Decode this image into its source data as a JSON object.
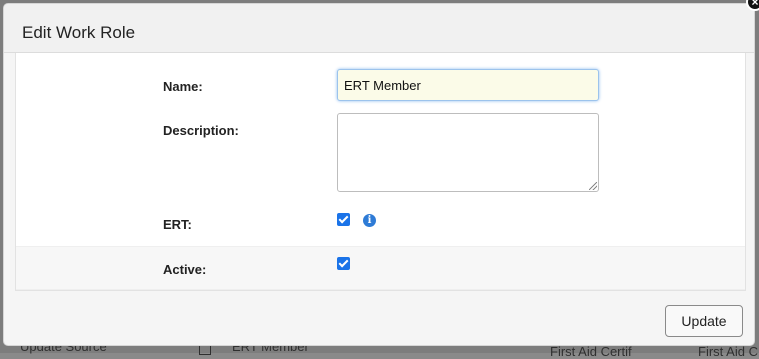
{
  "background": {
    "update_source_text": "Update Source",
    "ert_member_text": "ERT Member",
    "first_aid_1_text": "First Aid Certif",
    "first_aid_2_text": "First Aid C"
  },
  "dialog": {
    "title": "Edit Work Role",
    "fields": {
      "name_label": "Name:",
      "name_value": "ERT Member",
      "description_label": "Description:",
      "description_value": "",
      "ert_label": "ERT:",
      "ert_checked": true,
      "active_label": "Active:",
      "active_checked": true
    },
    "update_button_label": "Update"
  },
  "icons": {
    "info": "info-icon",
    "close": "close-icon",
    "info_glyph": "i",
    "close_glyph": "×"
  },
  "colors": {
    "accent": "#1a73e8",
    "focus_input_bg": "#fbfbe8"
  }
}
